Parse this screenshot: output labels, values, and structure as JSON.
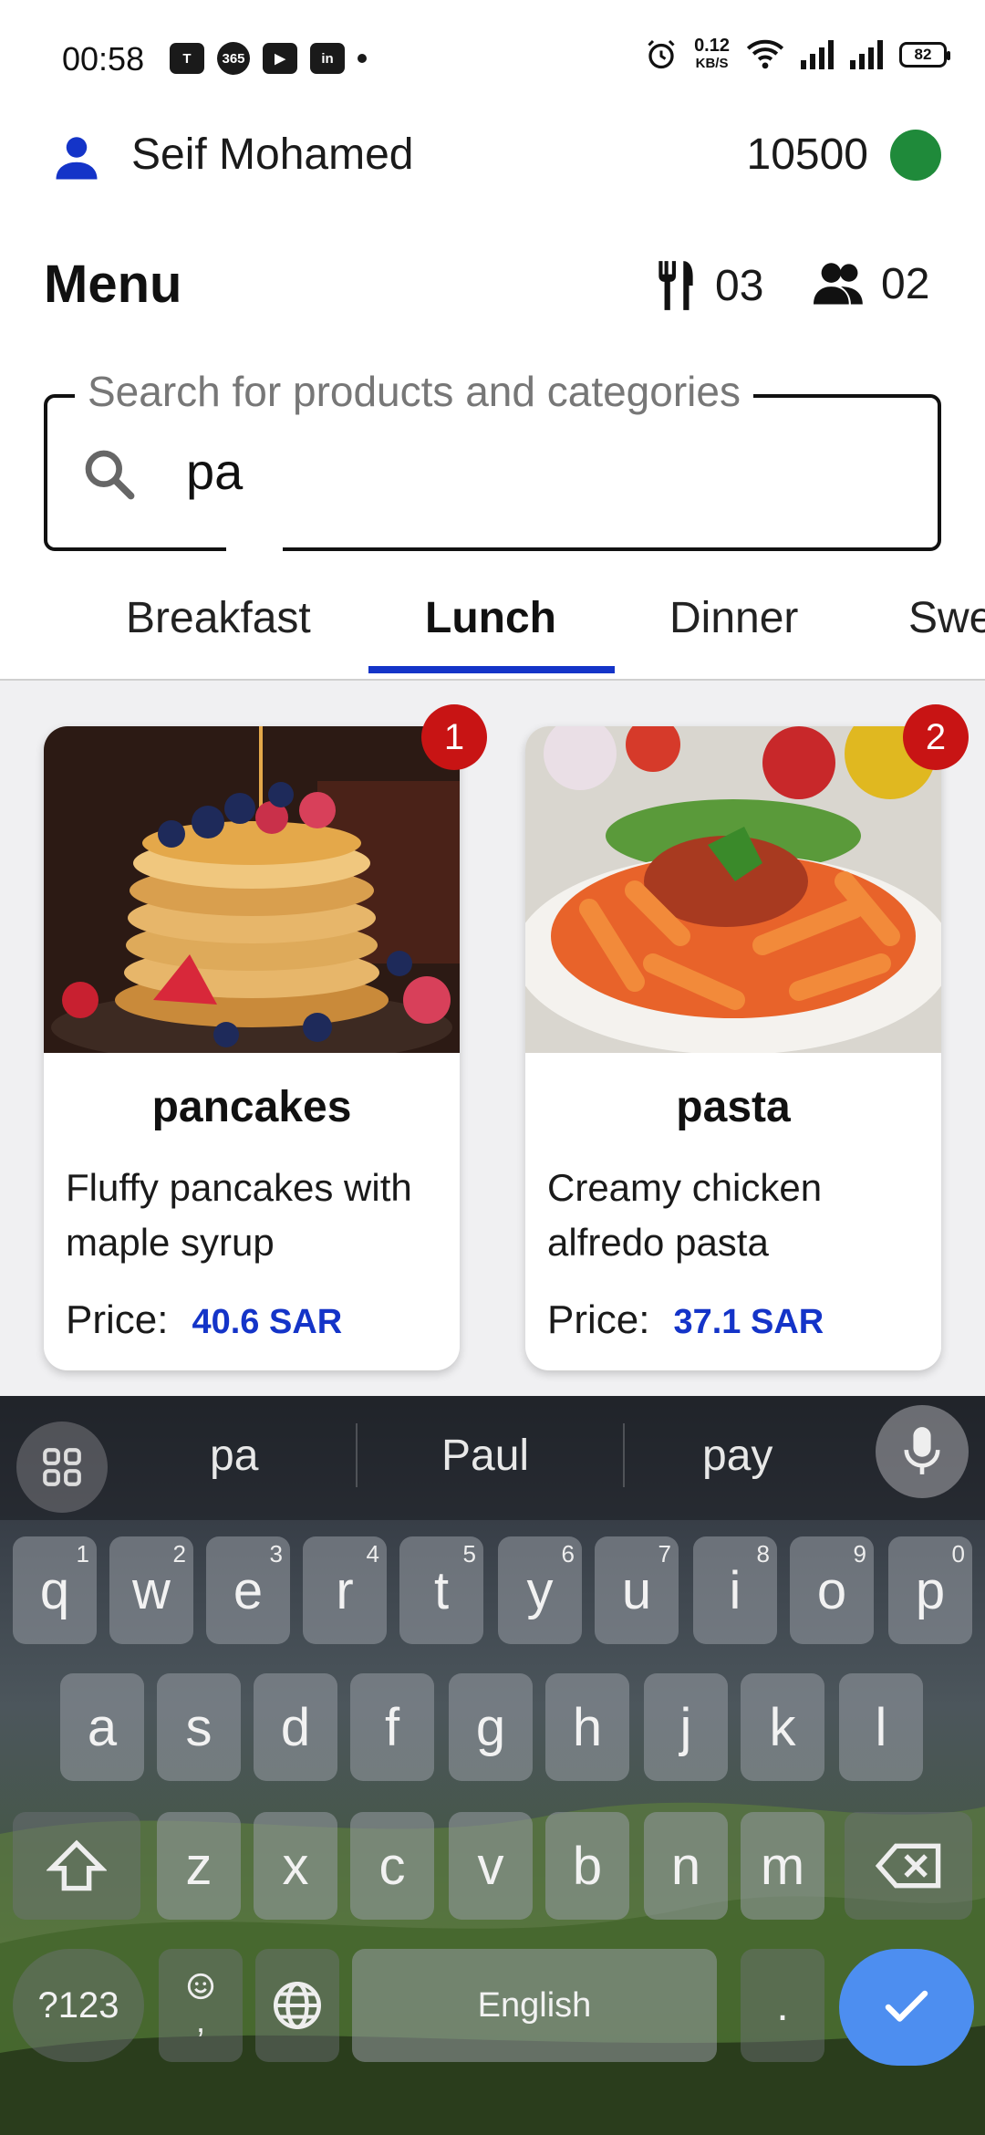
{
  "status_bar": {
    "time": "00:58",
    "apps": [
      "teams-icon",
      "365-icon",
      "youtube-icon",
      "linkedin-icon"
    ],
    "app_365_label": "365",
    "app_linkedin_label": "in",
    "net_speed_value": "0.12",
    "net_speed_unit": "KB/S",
    "battery": "82"
  },
  "header": {
    "user_name": "Seif Mohamed",
    "points": "10500",
    "status_color": "#1f8a3a"
  },
  "menu": {
    "title": "Menu",
    "tables_count": "03",
    "guests_count": "02"
  },
  "search": {
    "label": "Search for products and categories",
    "value": "pa"
  },
  "tabs": [
    {
      "label": "Breakfast"
    },
    {
      "label": "Lunch",
      "active": true
    },
    {
      "label": "Dinner"
    },
    {
      "label": "Swe"
    }
  ],
  "products": [
    {
      "badge": "1",
      "name": "pancakes",
      "description": "Fluffy pancakes with maple syrup",
      "price_label": "Price:",
      "price": "40.6 SAR"
    },
    {
      "badge": "2",
      "name": "pasta",
      "description": "Creamy chicken alfredo pasta",
      "price_label": "Price:",
      "price": "37.1 SAR"
    }
  ],
  "keyboard": {
    "suggestions": [
      "pa",
      "Paul",
      "pay"
    ],
    "row1": [
      "q",
      "w",
      "e",
      "r",
      "t",
      "y",
      "u",
      "i",
      "o",
      "p"
    ],
    "row1_hints": [
      "1",
      "2",
      "3",
      "4",
      "5",
      "6",
      "7",
      "8",
      "9",
      "0"
    ],
    "row2": [
      "a",
      "s",
      "d",
      "f",
      "g",
      "h",
      "j",
      "k",
      "l"
    ],
    "row3": [
      "z",
      "x",
      "c",
      "v",
      "b",
      "n",
      "m"
    ],
    "symbols_key": "?123",
    "comma_key": ",",
    "space_label": "English",
    "period_key": ".",
    "accent_color": "#4d8ef0"
  },
  "colors": {
    "accent": "#1434c8",
    "badge": "#c81414"
  }
}
